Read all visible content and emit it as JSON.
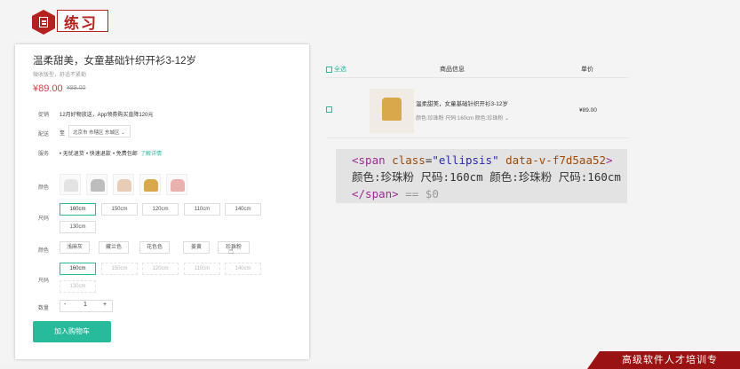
{
  "header": {
    "title": "练习"
  },
  "product": {
    "title": "温柔甜美，女童基础针织开衫3-12岁",
    "subtitle": "微收版型，舒适不紧勒",
    "price": "¥89.00",
    "old_price": "¥89.00",
    "promo_label": "促销",
    "promo_text": "12月好物放送，App领券购买直降120元",
    "ship_label": "配送",
    "ship_to": "至",
    "ship_region": "北京市 市辖区 东城区",
    "service_label": "服务",
    "services": [
      "• 无忧退货",
      "• 快速退款",
      "• 免费包邮"
    ],
    "service_link": "了解详情",
    "color_label": "颜色",
    "size_label": "尺码",
    "sizes": [
      "160cm",
      "150cm",
      "120cm",
      "110cm",
      "140cm",
      "130cm"
    ],
    "color_names": [
      "浅麻灰",
      "藏兰色",
      "花色色",
      "姜黄",
      "珍珠粉"
    ],
    "sizes2": [
      "160cm",
      "150cm",
      "120cm",
      "110cm",
      "140cm",
      "130cm"
    ],
    "qty_label": "数量",
    "qty_minus": "-",
    "qty_value": "1",
    "qty_plus": "+",
    "add_cart": "加入购物车"
  },
  "cart": {
    "select_all": "全选",
    "col_info": "商品信息",
    "col_price": "单价",
    "item_name": "温柔甜美，女童基础针织开衫3-12岁",
    "item_attrs": "颜色:珍珠粉 尺码:160cm 颜色:珍珠粉",
    "item_price": "¥89.00"
  },
  "devtools": {
    "open": "<span",
    "attr1": "class",
    "val1": "\"ellipsis\"",
    "attr2": "data-v-f7d5aa52",
    "close": ">",
    "text": "颜色:珍珠粉 尺码:160cm 颜色:珍珠粉 尺码:160cm ",
    "end_tag": "</span>",
    "eq": " == $0"
  },
  "footer": {
    "ribbon": "高级软件人才培训专"
  },
  "colors": {
    "accent": "#27ba9b",
    "brand_red": "#b5211f",
    "price_red": "#cf4444"
  }
}
